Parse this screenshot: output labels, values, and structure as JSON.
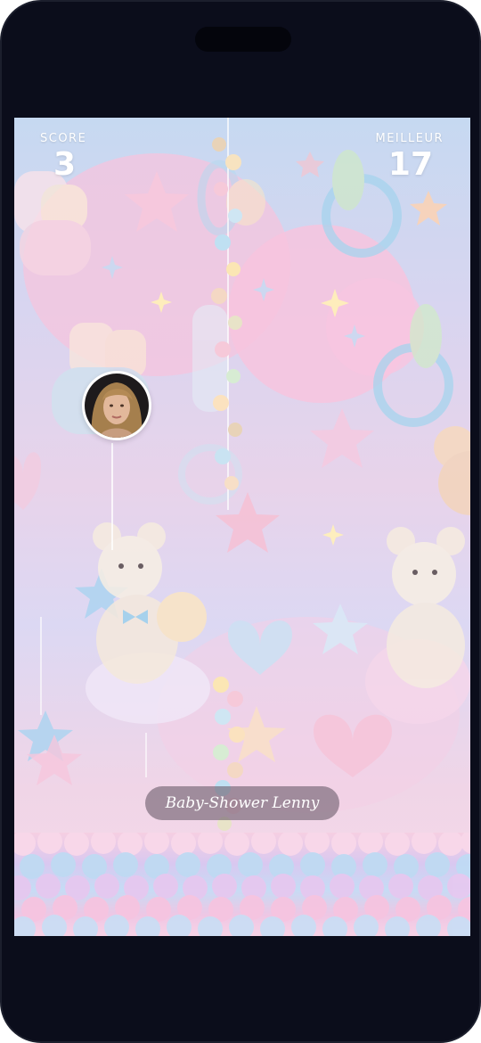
{
  "hud": {
    "score_label": "SCORE",
    "score_value": "3",
    "best_label": "MEILLEUR",
    "best_value": "17"
  },
  "player": {
    "name": "Baby-Shower Lenny"
  },
  "colors": {
    "sky_top": "#c6d9f1",
    "sky_mid": "#e8d3ea",
    "pink_cloud": "#f4c8dd",
    "pastel_blue": "#a9d3f0",
    "name_pill": "#6e5f6e"
  },
  "icons": [
    "teddy-bear-icon",
    "pacifier-icon",
    "star-icon",
    "heart-icon",
    "cloud-icon",
    "baby-bootie-icon",
    "baby-bottle-icon"
  ]
}
